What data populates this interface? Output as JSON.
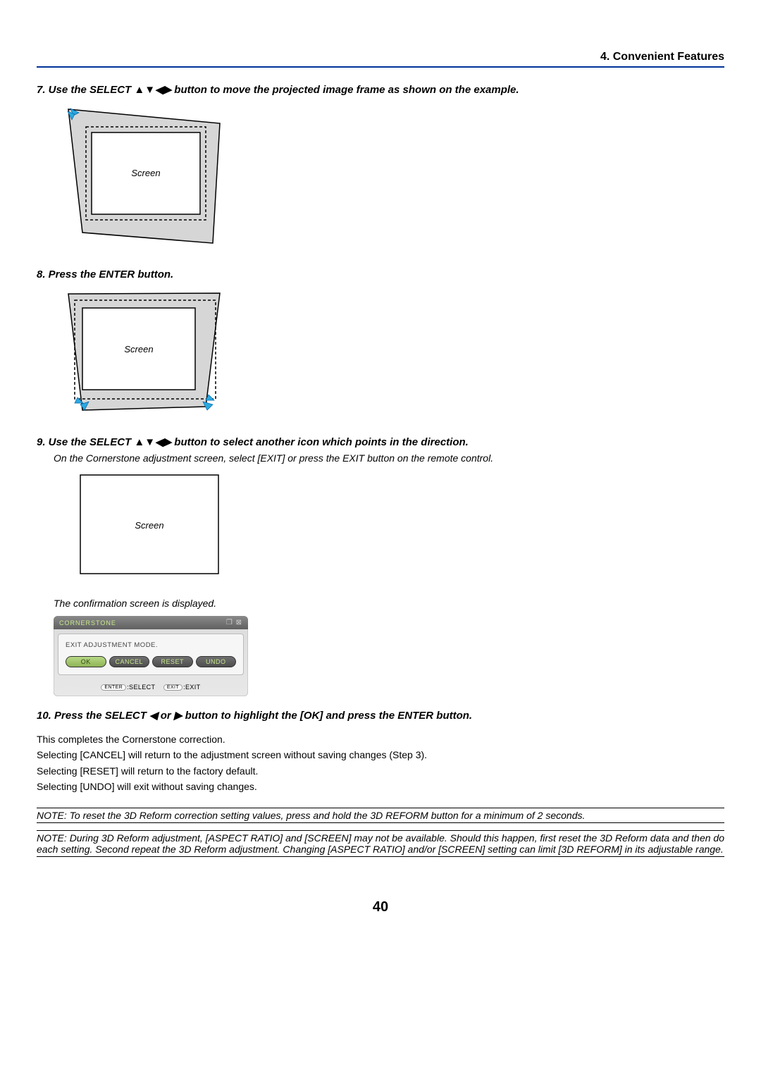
{
  "header": {
    "title": "4. Convenient Features"
  },
  "steps": {
    "s7": "7.  Use the SELECT ▲▼◀▶ button to move the projected image frame as shown on the example.",
    "s8": "8.  Press the ENTER button.",
    "s9": "9.  Use the SELECT ▲▼◀▶ button to select another icon which points in the direction.",
    "s9sub": "On the Cornerstone adjustment screen, select [EXIT] or press the EXIT button on the remote control.",
    "s9after": "The confirmation screen is displayed.",
    "s10": "10. Press the SELECT ◀ or ▶ button to highlight the [OK] and press the ENTER button."
  },
  "fig": {
    "screen_label": "Screen"
  },
  "dialog": {
    "title": "CORNERSTONE",
    "message": "EXIT ADJUSTMENT MODE.",
    "buttons": {
      "ok": "OK",
      "cancel": "CANCEL",
      "reset": "RESET",
      "undo": "UNDO"
    },
    "footer": {
      "enter_key": "ENTER",
      "enter_lbl": ":SELECT",
      "exit_key": "EXIT",
      "exit_lbl": ":EXIT"
    }
  },
  "body": {
    "l1": "This completes the Cornerstone correction.",
    "l2": "Selecting [CANCEL] will return to the adjustment screen without saving changes (Step 3).",
    "l3": "Selecting [RESET] will return to the factory default.",
    "l4": "Selecting [UNDO] will exit without saving changes."
  },
  "notes": {
    "n1": "NOTE: To reset the 3D Reform correction setting values, press and hold the 3D REFORM button for a minimum of 2 seconds.",
    "n2": "NOTE: During 3D Reform adjustment, [ASPECT RATIO] and [SCREEN] may not be available. Should this happen, first reset the 3D Reform data and then do each setting. Second repeat the 3D Reform adjustment. Changing [ASPECT RATIO] and/or [SCREEN] setting can limit [3D REFORM] in its adjustable range."
  },
  "page": {
    "number": "40"
  }
}
